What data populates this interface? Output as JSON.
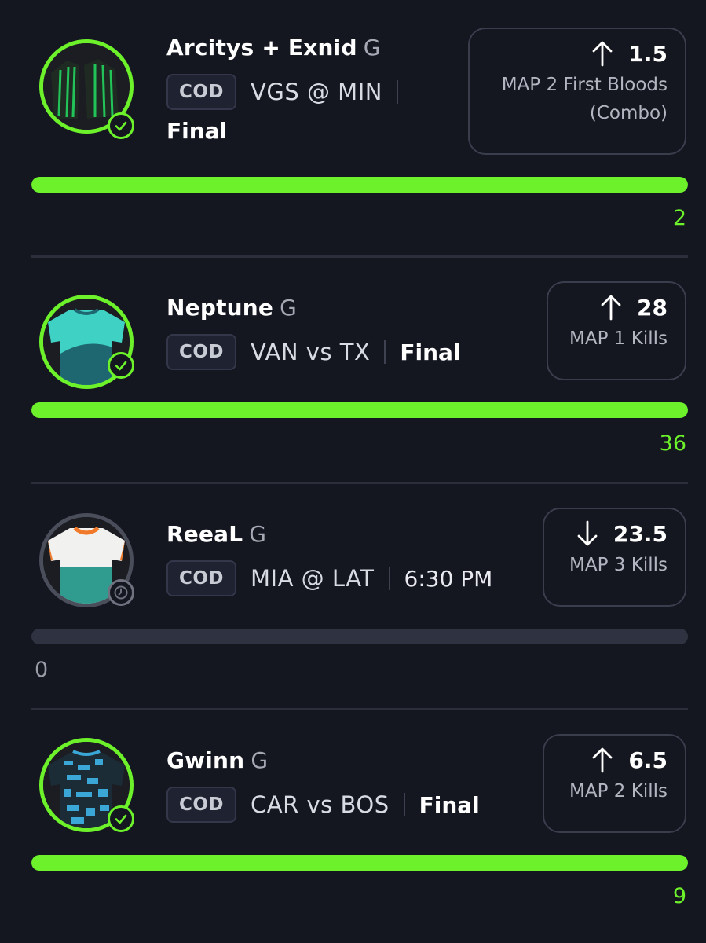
{
  "picks": [
    {
      "player": "Arcitys + Exnid",
      "position": "G",
      "league": "COD",
      "matchup": "VGS @ MIN",
      "status": "Final",
      "direction": "up",
      "line": "1.5",
      "stat": "MAP 2 First Bloods",
      "stat_sub": "(Combo)",
      "actual": "2",
      "progress": 1.0,
      "result": "settled",
      "jersey": "stripe-green"
    },
    {
      "player": "Neptune",
      "position": "G",
      "league": "COD",
      "matchup": "VAN vs TX",
      "status": "Final",
      "direction": "up",
      "line": "28",
      "stat": "MAP 1 Kills",
      "actual": "36",
      "progress": 1.0,
      "result": "settled",
      "jersey": "teal-wave"
    },
    {
      "player": "ReeaL",
      "position": "G",
      "league": "COD",
      "matchup": "MIA @ LAT",
      "status": "6:30 PM",
      "direction": "down",
      "line": "23.5",
      "stat": "MAP 3 Kills",
      "actual": "0",
      "progress": 0.0,
      "result": "pending",
      "jersey": "white-teal"
    },
    {
      "player": "Gwinn",
      "position": "G",
      "league": "COD",
      "matchup": "CAR vs BOS",
      "status": "Final",
      "direction": "up",
      "line": "6.5",
      "stat": "MAP 2 Kills",
      "actual": "9",
      "progress": 1.0,
      "result": "settled",
      "jersey": "blue-camo"
    }
  ],
  "colors": {
    "accent": "#6cf12b",
    "background": "#141620",
    "muted": "#b3b5c0"
  }
}
